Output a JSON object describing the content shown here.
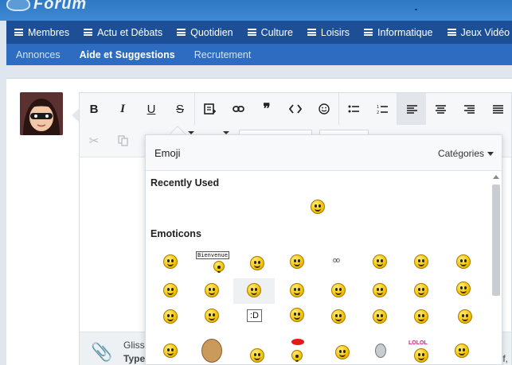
{
  "logo": {
    "text": "Forum"
  },
  "nav": {
    "items": [
      "Membres",
      "Actu et Débats",
      "Quotidien",
      "Culture",
      "Loisirs",
      "Informatique",
      "Jeux Vidéo"
    ]
  },
  "subnav": {
    "items": [
      "Annonces",
      "Aide et Suggestions",
      "Recrutement"
    ],
    "active_index": 1
  },
  "toolbar": {
    "row1": [
      "B",
      "I",
      "U",
      "S"
    ]
  },
  "dropzone": {
    "line1": "Gliss",
    "line2": "Type",
    "right": "f,"
  },
  "emoji_panel": {
    "title": "Emoji",
    "categories_label": "Catégories",
    "recent_label": "Recently Used",
    "emoticons_label": "Emoticons",
    "bienvenue_text": "Bienvenue",
    "text_emoji": ":D",
    "eyes_text": "oo",
    "banner_text": "LOLOL"
  },
  "colors": {
    "nav": "#1d4f97",
    "subnav": "#2d6cc0",
    "banner": "#3f8ad3"
  }
}
